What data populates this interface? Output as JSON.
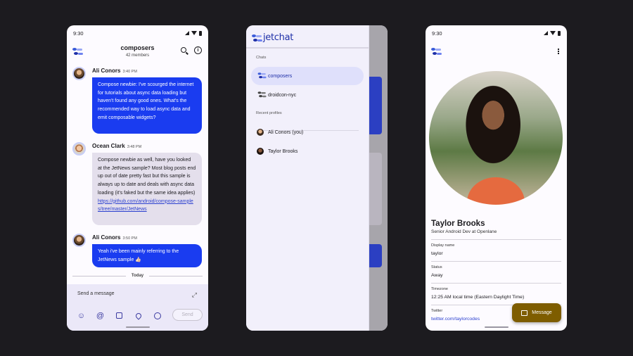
{
  "status_time": "9:30",
  "chat": {
    "channel_title": "composers",
    "members": "42 members",
    "messages": [
      {
        "author": "Ali Conors",
        "time": "3:40 PM",
        "text": "Compose newbie: I've scourged the internet for tutorials about async data loading but haven't found any good ones. What's the recommended way to load async data and emit composable widgets?"
      },
      {
        "author": "Ocean Clark",
        "time": "3:48 PM",
        "text": "Compose newbie as well, have you looked at the JetNews sample? Most blog posts end up out of date pretty fast but this sample is always up to date and deals with async data loading (it's faked but the same idea applies)",
        "link": "https://github.com/android/compose-samples/tree/master/JetNews"
      },
      {
        "author": "Ali Conors",
        "time": "3:50 PM",
        "text": "Yeah i've been mainly referring to the JetNews sample 👍🏻"
      }
    ],
    "day_divider": "Today",
    "input_placeholder": "Send a message",
    "send_label": "Send"
  },
  "drawer": {
    "brand": "jetchat",
    "chats_header": "Chats",
    "chats": [
      {
        "label": "composers",
        "active": true
      },
      {
        "label": "droidcon-nyc",
        "active": false
      }
    ],
    "profiles_header": "Recent profiles",
    "profiles": [
      {
        "label": "Ali Conors (you)"
      },
      {
        "label": "Taylor Brooks"
      }
    ]
  },
  "profile": {
    "name": "Taylor Brooks",
    "position": "Senior Android Dev at Openlane",
    "fields": [
      {
        "label": "Display name",
        "value": "taylor"
      },
      {
        "label": "Status",
        "value": "Away"
      },
      {
        "label": "Timezone",
        "value": "12:25 AM local time (Eastern Daylight Time)"
      },
      {
        "label": "Twitter",
        "value": "twitter.com/taylorcodes",
        "is_link": true
      }
    ],
    "fab_label": "Message"
  },
  "colors": {
    "background": "#1c1b1f",
    "primary_bubble": "#1a3cf0",
    "other_bubble": "#e4dfec",
    "fab": "#7e5d00",
    "link": "#2a3fcf"
  }
}
